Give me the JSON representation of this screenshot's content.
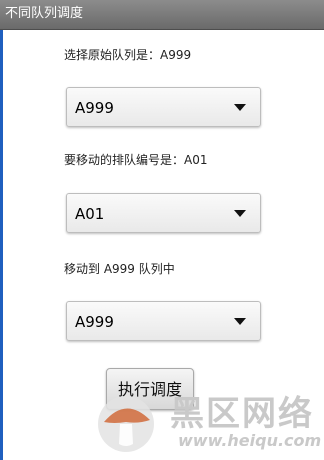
{
  "window": {
    "title": "不同队列调度"
  },
  "form": {
    "source_label": "选择原始队列是：A999",
    "source_value": "A999",
    "item_label": "要移动的排队编号是：A01",
    "item_value": "A01",
    "target_label": "移动到 A999 队列中",
    "target_value": "A999"
  },
  "actions": {
    "execute_label": "执行调度"
  },
  "watermark": {
    "text": "黑区网络",
    "url": "www.heiqu.com"
  },
  "icons": {
    "spinner_caret": "caret-down-icon",
    "watermark_logo": "mushroom-logo-icon"
  },
  "colors": {
    "title_bar": "#7a7a7a",
    "left_edge": "#1f5fbf",
    "watermark": "#c9c9c9"
  }
}
